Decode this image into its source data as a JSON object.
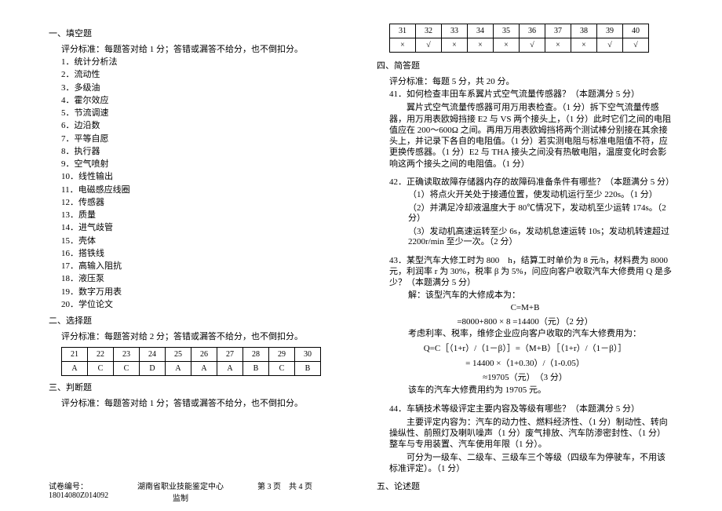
{
  "left": {
    "section1_title": "一、填空题",
    "criteria1": "评分标准：每题答对给 1 分；答错或漏答不给分，也不倒扣分。",
    "fills": [
      "1．统计分析法",
      "2．流动性",
      "3．多级油",
      "4．霍尔效应",
      "5．节流调速",
      "6．边沿数",
      "7．平等自愿",
      "8．执行器",
      "9．空气喷射",
      "10．线性输出",
      "11．电磁感应线圈",
      "12．传感器",
      "13．质量",
      "14．进气歧管",
      "15．壳体",
      "16．搭铁线",
      "17．高输入阻抗",
      "18．液压泵",
      "19．数字万用表",
      "20．学位论文"
    ],
    "section2_title": "二、选择题",
    "criteria2": "评分标准：每题答对给 2 分；答错或漏答不给分，也不倒扣分。",
    "table2_head": [
      "21",
      "22",
      "23",
      "24",
      "25",
      "26",
      "27",
      "28",
      "29",
      "30"
    ],
    "table2_ans": [
      "A",
      "C",
      "C",
      "D",
      "A",
      "A",
      "A",
      "B",
      "C",
      "B"
    ],
    "section3_title": "三、判断题",
    "criteria3": "评分标准：每题答对给 1 分；答错或漏答不给分，也不倒扣分。"
  },
  "right": {
    "table3_head": [
      "31",
      "32",
      "33",
      "34",
      "35",
      "36",
      "37",
      "38",
      "39",
      "40"
    ],
    "table3_ans": [
      "×",
      "√",
      "×",
      "×",
      "×",
      "√",
      "×",
      "×",
      "√",
      "√"
    ],
    "section4_title": "四、简答题",
    "criteria4": "评分标准：每题 5 分，共 20 分。",
    "q41_title": "41．如何检查丰田车系翼片式空气流量传感器？（本题满分 5 分）",
    "q41_body": "翼片式空气流量传感器可用万用表检查。（1 分）拆下空气流量传感器，用万用表欧姆挡接 E2 与 VS 两个接头上，（1 分）此时它们之间的电阻值应在 200～600Ω 之间。再用万用表欧姆挡将两个测试棒分别接在其余接头上，并记录下各自的电阻值。（1 分）若实测电阻与标准电阻值不符，应更换传感器。（1 分）E2 与 THA 接头之间没有热敏电阻，温度变化时会影响这两个接头之间的电阻值。（1 分）",
    "q42_title": "42．正确读取故障存储器内存的故障码准备条件有哪些？（本题满分 5 分）",
    "q42_1": "（1）将点火开关处于接通位置，使发动机运行至少 220s。（1 分）",
    "q42_2": "（2）并满足冷却液温度大于 80℃情况下，发动机至少运转 174s。（2 分）",
    "q42_3": "（3）发动机高速运转至少 6s，发动机怠速运转 10s；发动机转速超过 2200r/min 至少一次。（2 分）",
    "q43_title": "43．某型汽车大修工时为 800　h，结算工时单价为 8 元/h，材料费为 8000 元，利润率 r 为 30%，税率 β 为 5%，问应向客户收取汽车大修费用 Q 是多少？（本题满分 5 分）",
    "q43_l1": "解：该型汽车的大修成本为：",
    "q43_m1": "C=M+B",
    "q43_m2": "=8000+800 × 8 =14400（元）（2 分）",
    "q43_l2": "考虑利率、税率，维修企业应向客户收取的汽车大修费用为：",
    "q43_m3": "Q=C［（1+r）/（1－β）］=（M+B）［（1+r）/（1－β）］",
    "q43_m4": "= 14400 ×（1+0.30）/（1-0.05）",
    "q43_m5": "≈19705（元）　（3 分）",
    "q43_l3": "该车的汽车大修费用约为 19705 元。",
    "q44_title": "44．车辆技术等级评定主要内容及等级有哪些？（本题满分 5 分）",
    "q44_body1": "主要评定内容为：汽车的动力性、燃料经济性、（1 分）制动性、转向操纵性、前照灯及喇叭噪声（1 分）废气排放、汽车防渗密封性、（1 分）整车与专用装置、汽车使用年限（1 分）。",
    "q44_body2": "可分为一级车、二级车、三级车三个等级（四级车为停驶车，不用该标准评定）。（1 分）",
    "section5_title": "五、论述题"
  },
  "footer": {
    "left": "试卷编号：18014080Z014092",
    "center": "湖南省职业技能鉴定中心监制",
    "right_l": "第 3 页　共 4 页"
  }
}
